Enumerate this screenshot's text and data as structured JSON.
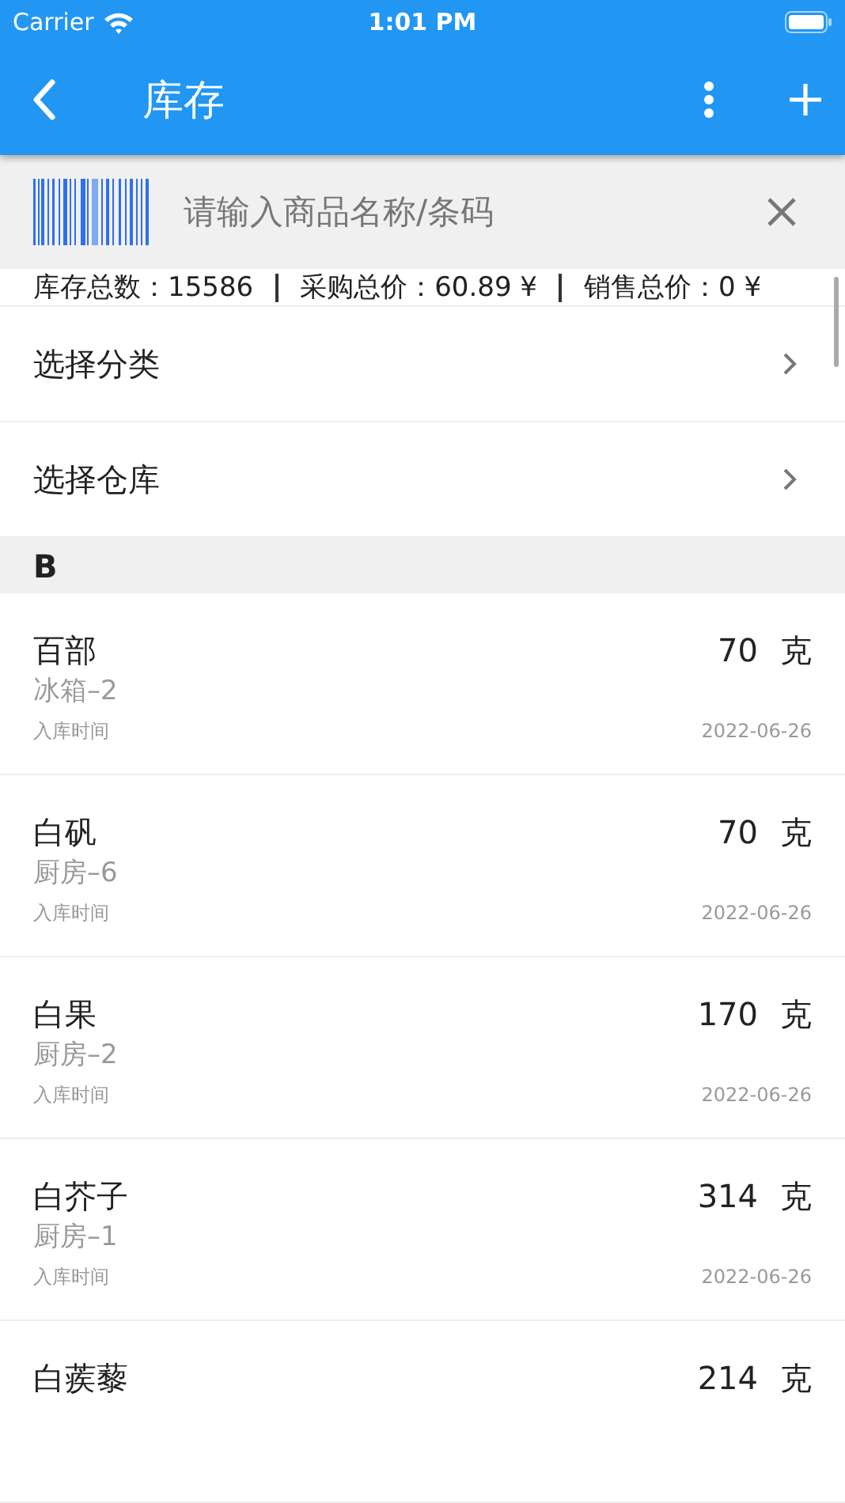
{
  "status_bar": {
    "carrier": "Carrier",
    "time": "1:01 PM"
  },
  "app_bar": {
    "title": "库存"
  },
  "search": {
    "placeholder": "请输入商品名称/条码"
  },
  "summary": [
    "库存总数：15586",
    "采购总价：60.89 ¥",
    "销售总价：0 ¥"
  ],
  "pickers": [
    {
      "label": "选择分类"
    },
    {
      "label": "选择仓库"
    }
  ],
  "section": {
    "letter": "B"
  },
  "items": [
    {
      "name": "百部",
      "location": "冰箱–2",
      "time_label": "入库时间",
      "quantity": "70",
      "unit": "克",
      "date": "2022-06-26"
    },
    {
      "name": "白矾",
      "location": "厨房–6",
      "time_label": "入库时间",
      "quantity": "70",
      "unit": "克",
      "date": "2022-06-26"
    },
    {
      "name": "白果",
      "location": "厨房–2",
      "time_label": "入库时间",
      "quantity": "170",
      "unit": "克",
      "date": "2022-06-26"
    },
    {
      "name": "白芥子",
      "location": "厨房–1",
      "time_label": "入库时间",
      "quantity": "314",
      "unit": "克",
      "date": "2022-06-26"
    },
    {
      "name": "白蒺藜",
      "quantity": "214",
      "unit": "克"
    }
  ]
}
